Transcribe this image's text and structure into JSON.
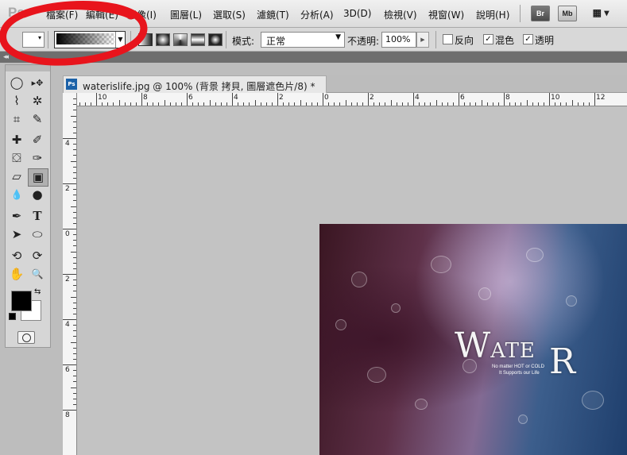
{
  "app": {
    "logo": "Ps"
  },
  "menu": [
    "檔案(F)",
    "編輯(E)",
    "影像(I)",
    "圖層(L)",
    "選取(S)",
    "濾鏡(T)",
    "分析(A)",
    "3D(D)",
    "檢視(V)",
    "視窗(W)",
    "說明(H)"
  ],
  "menu_buttons": {
    "bridge": "Br",
    "mini_bridge": "Mb",
    "screen_mode": "▦ ▾"
  },
  "options": {
    "mode_label": "模式:",
    "mode_value": "正常",
    "opacity_label": "不透明:",
    "opacity_value": "100%",
    "reverse_label": "反向",
    "dither_label": "混色",
    "transparency_label": "透明",
    "reverse_checked": false,
    "dither_checked": true,
    "transparency_checked": true
  },
  "panel": {
    "collapse": "◂◂"
  },
  "tools": {
    "marquee": "◯",
    "move": "▸✥",
    "lasso": "⌇",
    "magic_wand": "✲",
    "crop": "⌗",
    "eyedropper": "✎",
    "healing": "✚",
    "brush": "✐",
    "stamp": "⛋",
    "history_brush": "✑",
    "eraser": "▱",
    "gradient": "▣",
    "blur": "💧",
    "dodge": "●",
    "pen": "✒",
    "type": "T",
    "path_select": "➤",
    "shape": "⬭",
    "rotate_3d": "⟲",
    "orbit_3d": "⟳",
    "hand": "✋",
    "zoom": "🔍"
  },
  "document": {
    "icon": "Ps",
    "title": "waterislife.jpg @ 100% (背景 拷貝, 圖層遮色片/8) *"
  },
  "ruler_h": [
    "10",
    "8",
    "6",
    "4",
    "2",
    "0",
    "2",
    "4",
    "6",
    "8",
    "10",
    "12"
  ],
  "ruler_v": [
    "4",
    "2",
    "0",
    "2",
    "4",
    "6",
    "8"
  ],
  "artwork": {
    "w": "W",
    "ate": "ATE",
    "r": "R",
    "sub1": "No matter HOT or COLD",
    "sub2": "It Supports our Life"
  },
  "colors": {
    "annotation": "#e8141c",
    "accent": "#1c62a8"
  }
}
